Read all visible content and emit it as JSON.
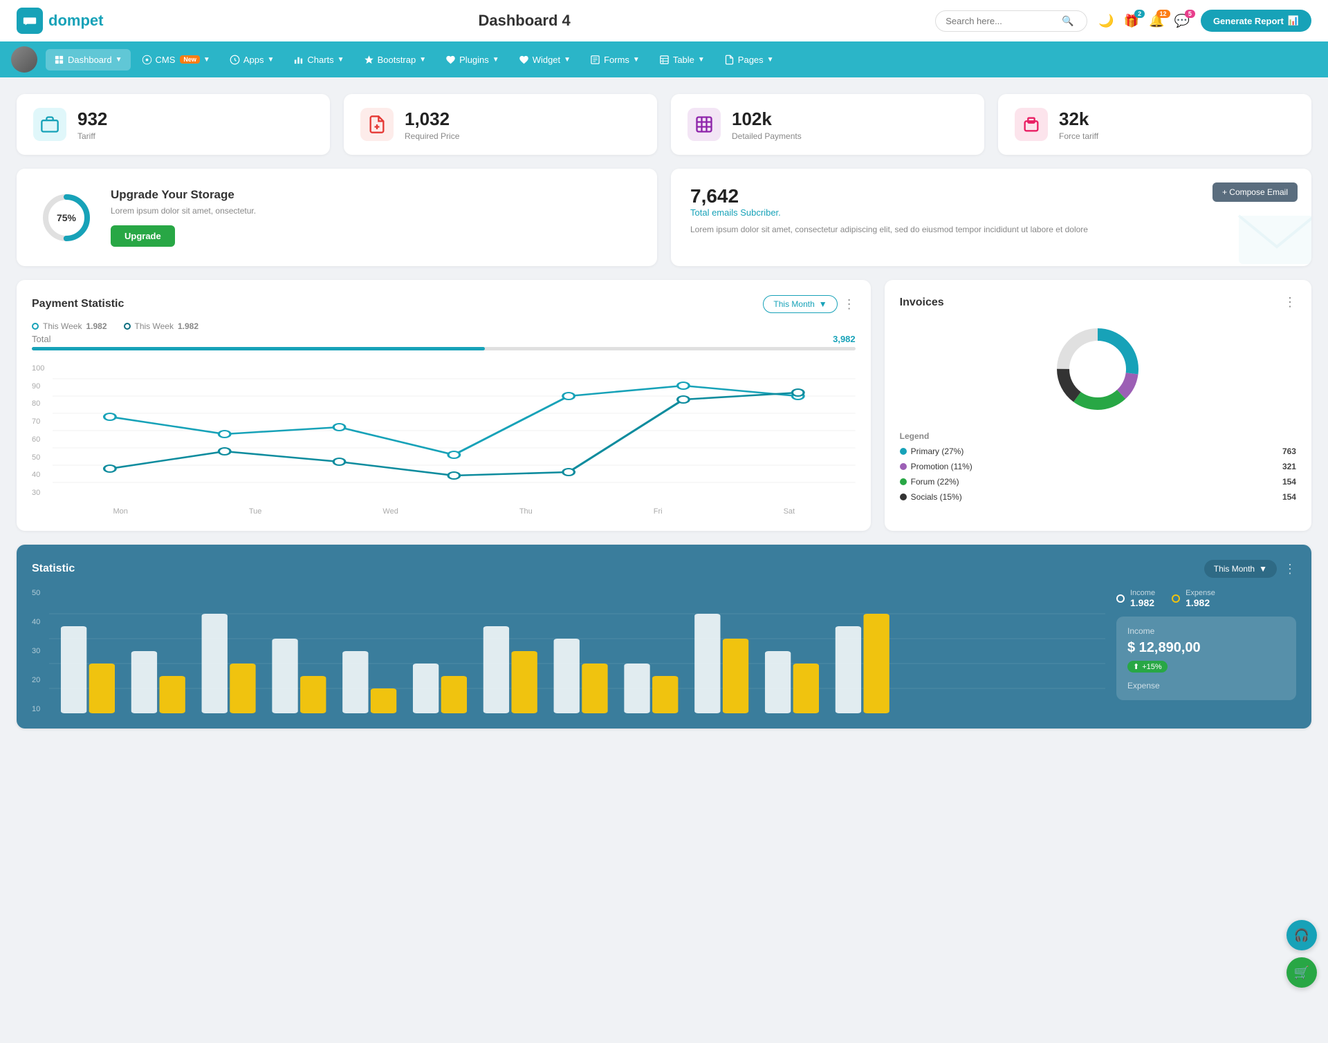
{
  "header": {
    "logo_text": "dompet",
    "page_title": "Dashboard 4",
    "search_placeholder": "Search here...",
    "generate_btn": "Generate Report",
    "badges": {
      "gift": "2",
      "bell": "12",
      "chat": "5"
    }
  },
  "navbar": {
    "items": [
      {
        "id": "dashboard",
        "label": "Dashboard",
        "active": true,
        "has_arrow": true
      },
      {
        "id": "cms",
        "label": "CMS",
        "active": false,
        "has_arrow": true,
        "has_new": true
      },
      {
        "id": "apps",
        "label": "Apps",
        "active": false,
        "has_arrow": true
      },
      {
        "id": "charts",
        "label": "Charts",
        "active": false,
        "has_arrow": true
      },
      {
        "id": "bootstrap",
        "label": "Bootstrap",
        "active": false,
        "has_arrow": true
      },
      {
        "id": "plugins",
        "label": "Plugins",
        "active": false,
        "has_arrow": true
      },
      {
        "id": "widget",
        "label": "Widget",
        "active": false,
        "has_arrow": true
      },
      {
        "id": "forms",
        "label": "Forms",
        "active": false,
        "has_arrow": true
      },
      {
        "id": "table",
        "label": "Table",
        "active": false,
        "has_arrow": true
      },
      {
        "id": "pages",
        "label": "Pages",
        "active": false,
        "has_arrow": true
      }
    ]
  },
  "stat_cards": [
    {
      "id": "tariff",
      "value": "932",
      "label": "Tariff",
      "icon_color": "teal"
    },
    {
      "id": "required_price",
      "value": "1,032",
      "label": "Required Price",
      "icon_color": "red"
    },
    {
      "id": "detailed_payments",
      "value": "102k",
      "label": "Detailed Payments",
      "icon_color": "purple"
    },
    {
      "id": "force_tariff",
      "value": "32k",
      "label": "Force tariff",
      "icon_color": "pink"
    }
  ],
  "storage": {
    "percent": "75%",
    "title": "Upgrade Your Storage",
    "description": "Lorem ipsum dolor sit amet, onsectetur.",
    "btn_label": "Upgrade",
    "donut_value": 75
  },
  "email": {
    "count": "7,642",
    "sub_label": "Total emails Subcriber.",
    "description": "Lorem ipsum dolor sit amet, consectetur adipiscing elit, sed do eiusmod tempor incididunt ut labore et dolore",
    "compose_btn": "+ Compose Email"
  },
  "payment": {
    "title": "Payment Statistic",
    "filter_label": "This Month",
    "dots": "⋮",
    "legend": [
      {
        "label": "This Week",
        "value": "1.982"
      },
      {
        "label": "This Week",
        "value": "1.982"
      }
    ],
    "total_label": "Total",
    "total_value": "3,982",
    "x_labels": [
      "Mon",
      "Tue",
      "Wed",
      "Thu",
      "Fri",
      "Sat"
    ],
    "y_labels": [
      "100",
      "90",
      "80",
      "70",
      "60",
      "50",
      "40",
      "30"
    ],
    "line1_points": "30,160 120,130 210,100 300,80 390,120 480,100 570,30 660,40",
    "line2_points": "30,170 120,150 210,160 300,170 390,155 480,160 570,60 660,50"
  },
  "invoices": {
    "title": "Invoices",
    "legend": [
      {
        "label": "Primary (27%)",
        "color": "#17a2b8",
        "value": "763"
      },
      {
        "label": "Promotion (11%)",
        "color": "#9c5fb5",
        "value": "321"
      },
      {
        "label": "Forum (22%)",
        "color": "#28a745",
        "value": "154"
      },
      {
        "label": "Socials (15%)",
        "color": "#333",
        "value": "154"
      }
    ]
  },
  "statistic": {
    "title": "Statistic",
    "filter_label": "This Month",
    "y_labels": [
      "50",
      "40",
      "30",
      "20",
      "10"
    ],
    "income_label": "Income",
    "income_value": "1.982",
    "expense_label": "Expense",
    "expense_value": "1.982",
    "income_box": {
      "label": "Income",
      "amount": "$ 12,890,00",
      "growth": "+15%"
    },
    "expense_box_label": "Expense"
  }
}
